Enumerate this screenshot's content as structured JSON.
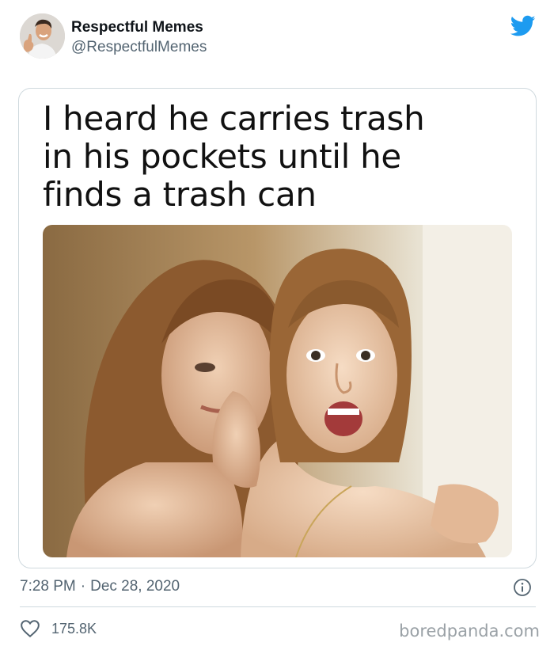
{
  "tweet": {
    "display_name": "Respectful Memes",
    "handle": "@RespectfulMemes",
    "time": "7:28 PM",
    "separator": "·",
    "date": "Dec 28, 2020",
    "likes": "175.8K"
  },
  "meme": {
    "caption": "I heard he carries trash\nin his pockets until he\nfinds a trash can"
  },
  "watermark": "boredpanda.com",
  "icons": {
    "brand": "twitter-bird-icon",
    "info": "info-icon",
    "like": "heart-icon"
  },
  "colors": {
    "twitter_blue": "#1d9bf0",
    "secondary_text": "#536471",
    "border": "#cfd9de"
  }
}
